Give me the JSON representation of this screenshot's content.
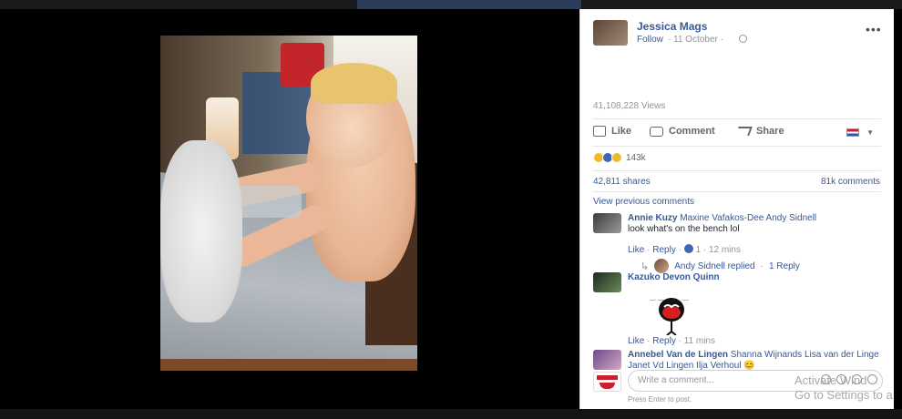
{
  "post": {
    "author": "Jessica Mags",
    "follow": "Follow",
    "date": "· 11 October ·",
    "views": "41,108,228 Views",
    "more": "•••"
  },
  "actions": {
    "like": "Like",
    "comment": "Comment",
    "share": "Share"
  },
  "reactions": {
    "count": "143k",
    "shares": "42,811 shares",
    "comments": "81k comments"
  },
  "comments": {
    "view_previous": "View previous comments",
    "items": [
      {
        "name": "Annie Kuzy",
        "tags": "Maxine Vafakos-Dee Andy Sidnell",
        "text": "look what's on the bench lol",
        "like": "Like",
        "reply": "Reply",
        "reaction_count": "1",
        "time": "12 mins",
        "reply_summary": "Andy Sidnell replied",
        "reply_count": "1 Reply"
      },
      {
        "name": "Kazuko Devon Quinn",
        "like": "Like",
        "reply": "Reply",
        "time": "11 mins"
      },
      {
        "name": "Annebel Van de Lingen",
        "text": "Shanna Wijnands Lisa van der Linge Janet Vd Lingen Ilja Verhoul 😊"
      }
    ]
  },
  "composer": {
    "placeholder": "Write a comment...",
    "hint": "Press Enter to post."
  },
  "watermark": {
    "line1": "Activate Wind",
    "line2": "Go to Settings to a"
  },
  "colors": {
    "link": "#365899",
    "muted": "#90949c",
    "text": "#1d2129",
    "brand_blue": "#4267b2"
  }
}
